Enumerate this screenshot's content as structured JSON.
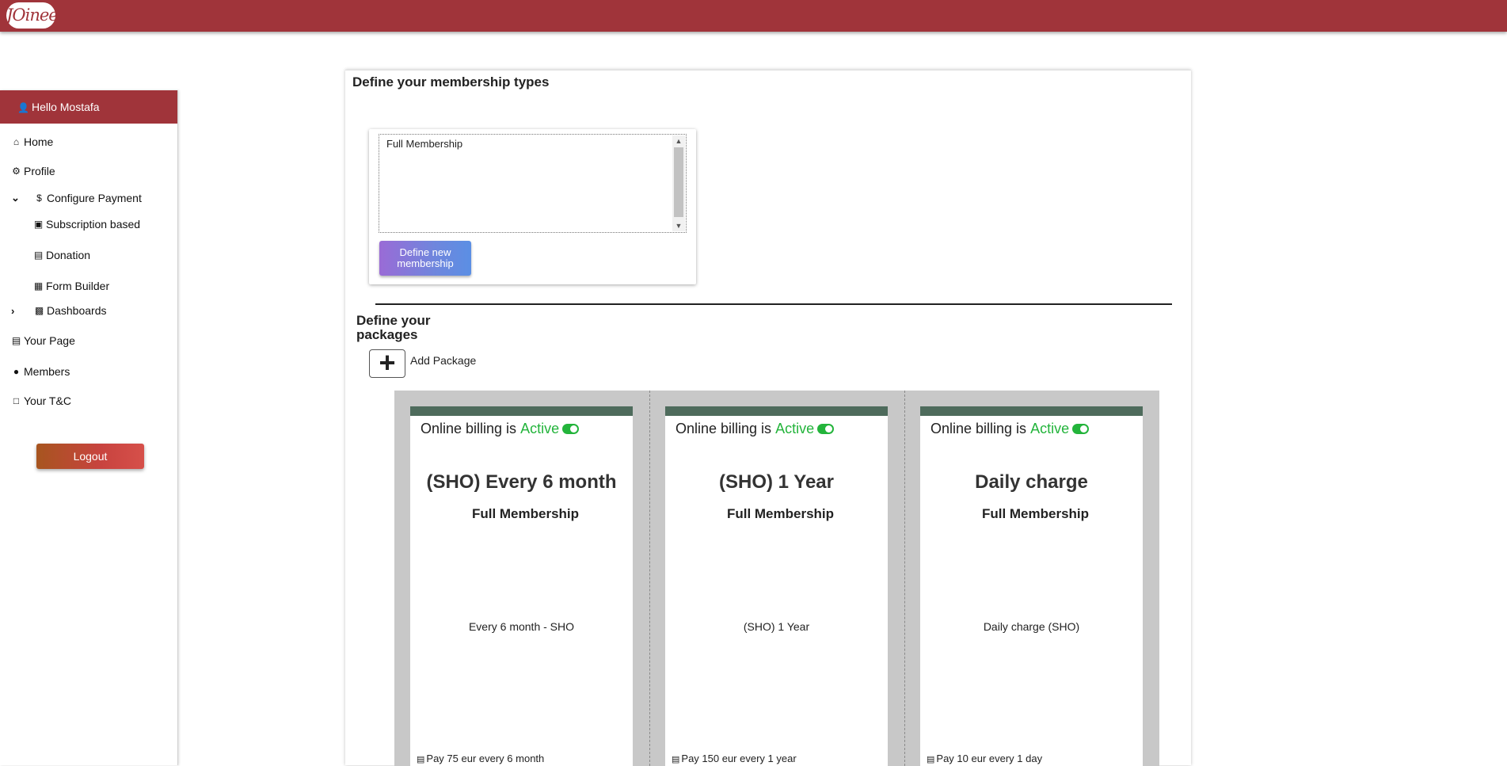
{
  "header": {
    "logo_text": "JOinee",
    "brand_color": "#a0343a"
  },
  "sidebar": {
    "greeting": "Hello Mostafa",
    "items": [
      {
        "label": "Home",
        "icon": "home-icon"
      },
      {
        "label": "Profile",
        "icon": "gear-icon"
      },
      {
        "label": "Configure Payment",
        "icon": "dollar-icon",
        "expanded": true
      },
      {
        "label": "Subscription based",
        "icon": "briefcase-icon"
      },
      {
        "label": "Donation",
        "icon": "money-icon"
      },
      {
        "label": "Form Builder",
        "icon": "form-icon"
      },
      {
        "label": "Dashboards",
        "icon": "bar-chart-icon",
        "expanded": false
      },
      {
        "label": "Your Page",
        "icon": "page-icon"
      },
      {
        "label": "Members",
        "icon": "users-icon"
      },
      {
        "label": "Your T&C",
        "icon": "document-icon"
      }
    ],
    "logout_label": "Logout"
  },
  "main": {
    "membership_title": "Define your membership types",
    "membership_list": [
      "Full Membership"
    ],
    "define_button_label": "Define new membership",
    "packages_title": "Define your packages",
    "add_package_label": "Add Package",
    "billing_prefix": "Online billing is",
    "billing_status": "Active",
    "active_color": "#23b43b",
    "packages": [
      {
        "name": "(SHO) Every 6 month",
        "membership": "Full Membership",
        "description": "Every 6 month - SHO",
        "price": "Pay 75 eur every 6 month"
      },
      {
        "name": "(SHO) 1 Year",
        "membership": "Full Membership",
        "description": "(SHO) 1 Year",
        "price": "Pay 150 eur every 1 year"
      },
      {
        "name": "Daily charge",
        "membership": "Full Membership",
        "description": "Daily charge (SHO)",
        "price": "Pay 10 eur every 1 day"
      }
    ]
  }
}
